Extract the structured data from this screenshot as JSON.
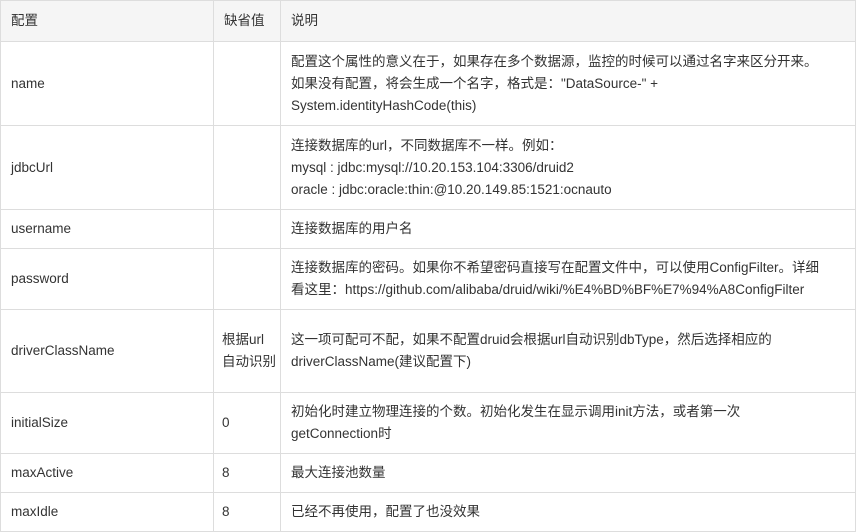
{
  "table": {
    "headers": {
      "config": "配置",
      "default": "缺省值",
      "description": "说明"
    },
    "rows": [
      {
        "name": "name",
        "default": "",
        "description": [
          "配置这个属性的意义在于，如果存在多个数据源，监控的时候可以通过名字来区分开来。",
          "如果没有配置，将会生成一个名字，格式是：\"DataSource-\" +",
          "System.identityHashCode(this)"
        ]
      },
      {
        "name": "jdbcUrl",
        "default": "",
        "description": [
          "连接数据库的url，不同数据库不一样。例如：",
          "mysql : jdbc:mysql://10.20.153.104:3306/druid2",
          "oracle : jdbc:oracle:thin:@10.20.149.85:1521:ocnauto"
        ]
      },
      {
        "name": "username",
        "default": "",
        "description": [
          "连接数据库的用户名"
        ]
      },
      {
        "name": "password",
        "default": "",
        "description": [
          "连接数据库的密码。如果你不希望密码直接写在配置文件中，可以使用ConfigFilter。详细",
          "看这里：https://github.com/alibaba/druid/wiki/%E4%BD%BF%E7%94%A8ConfigFilter"
        ]
      },
      {
        "name": "driverClassName",
        "default": "根据url自动识别",
        "description": [
          "这一项可配可不配，如果不配置druid会根据url自动识别dbType，然后选择相应的",
          "driverClassName(建议配置下)"
        ]
      },
      {
        "name": "initialSize",
        "default": "0",
        "description": [
          "初始化时建立物理连接的个数。初始化发生在显示调用init方法，或者第一次",
          "getConnection时"
        ]
      },
      {
        "name": "maxActive",
        "default": "8",
        "description": [
          "最大连接池数量"
        ]
      },
      {
        "name": "maxIdle",
        "default": "8",
        "description": [
          "已经不再使用，配置了也没效果"
        ]
      }
    ]
  }
}
